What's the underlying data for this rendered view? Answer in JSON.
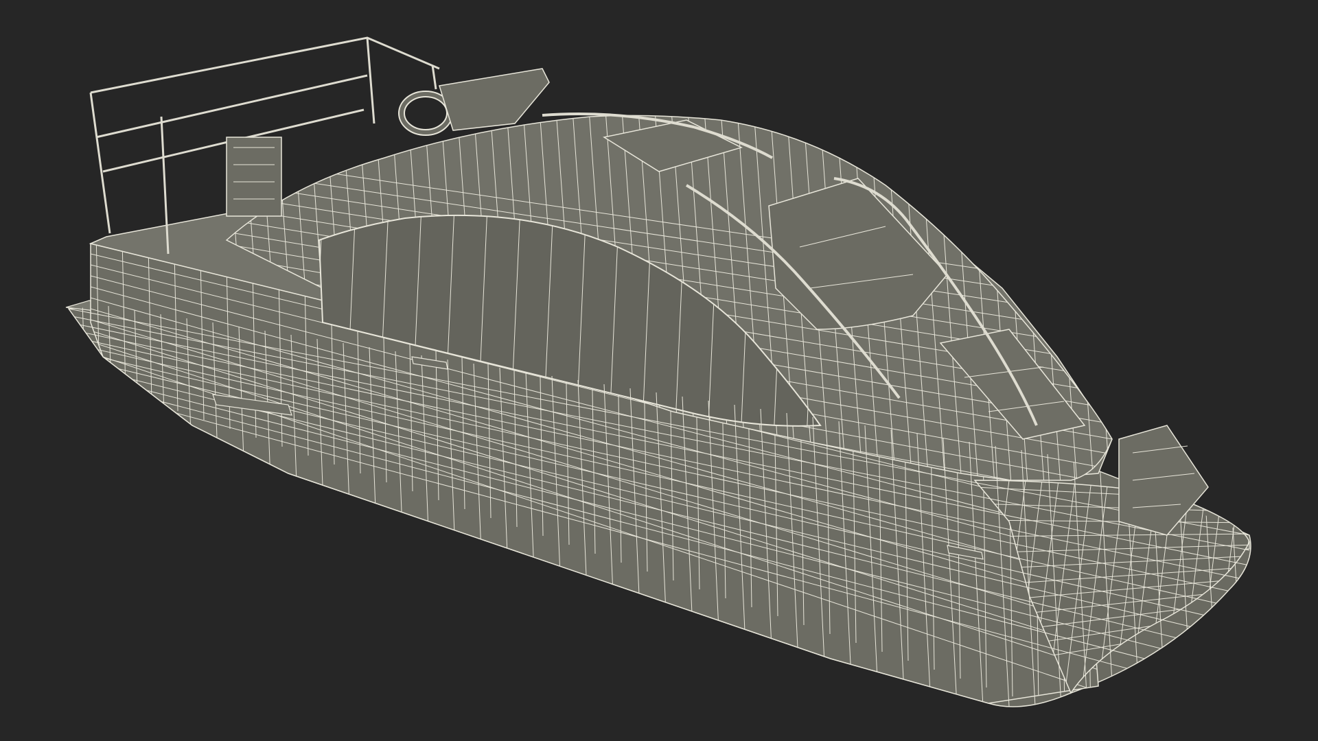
{
  "scene": {
    "subject": "boat-wireframe-render",
    "colors": {
      "background": "#262626",
      "surface": "#6f6f66",
      "surface_dark": "#5f5f57",
      "surface_light": "#7a7a70",
      "wire": "#e8e6da",
      "shadow_line": "#3c3c36"
    }
  }
}
